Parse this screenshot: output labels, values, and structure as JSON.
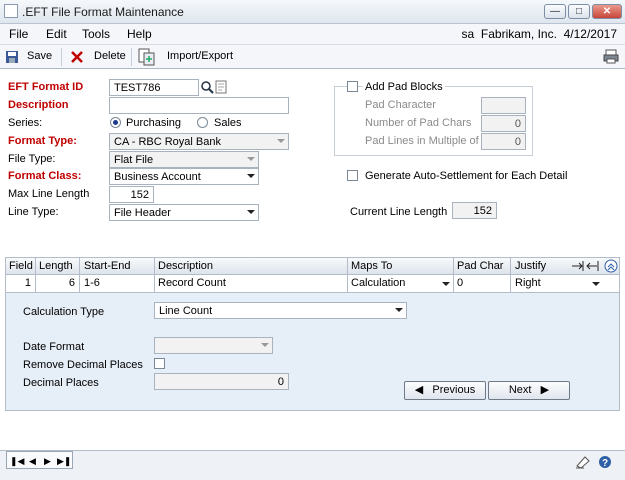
{
  "window": {
    "title": ".EFT File Format Maintenance",
    "buttons": [
      "minimize",
      "maximize",
      "close"
    ]
  },
  "menu": {
    "items": [
      "File",
      "Edit",
      "Tools",
      "Help"
    ],
    "user": "sa",
    "company": "Fabrikam, Inc.",
    "date": "4/12/2017"
  },
  "toolbar": {
    "save": "Save",
    "delete": "Delete",
    "import_export": "Import/Export"
  },
  "form": {
    "format_id_label": "EFT Format ID",
    "format_id": "TEST786",
    "description_label": "Description",
    "description": "",
    "series_label": "Series:",
    "series_options": [
      "Purchasing",
      "Sales"
    ],
    "series_selected": "Purchasing",
    "format_type_label": "Format Type:",
    "format_type": "CA - RBC Royal Bank",
    "file_type_label": "File Type:",
    "file_type": "Flat File",
    "format_class_label": "Format Class:",
    "format_class": "Business Account",
    "max_line_label": "Max Line Length",
    "max_line": "152",
    "line_type_label": "Line Type:",
    "line_type": "File Header"
  },
  "pad": {
    "add_pad_label": "Add Pad Blocks",
    "add_pad_checked": false,
    "pad_char_label": "Pad Character",
    "pad_char": "",
    "num_pad_label": "Number of Pad Chars",
    "num_pad": "0",
    "pad_lines_label": "Pad Lines in Multiple of",
    "pad_lines": "0"
  },
  "auto_settle": {
    "label": "Generate Auto-Settlement for Each Detail",
    "checked": false
  },
  "current_line": {
    "label": "Current Line Length",
    "value": "152"
  },
  "grid": {
    "headers": [
      "Field",
      "Length",
      "Start-End",
      "Description",
      "Maps To",
      "Pad Char",
      "Justify"
    ],
    "rows": [
      {
        "field": "1",
        "length": "6",
        "start_end": "1-6",
        "description": "Record Count",
        "maps_to": "Calculation",
        "pad_char": "0",
        "justify": "Right"
      }
    ]
  },
  "detail": {
    "calc_type_label": "Calculation Type",
    "calc_type": "Line Count",
    "date_format_label": "Date Format",
    "date_format": "",
    "remove_decimal_label": "Remove Decimal Places",
    "remove_decimal_checked": false,
    "decimal_places_label": "Decimal Places",
    "decimal_places": "0",
    "previous": "Previous",
    "next": "Next"
  },
  "status": {
    "nav": [
      "first",
      "previous",
      "next",
      "last"
    ]
  }
}
